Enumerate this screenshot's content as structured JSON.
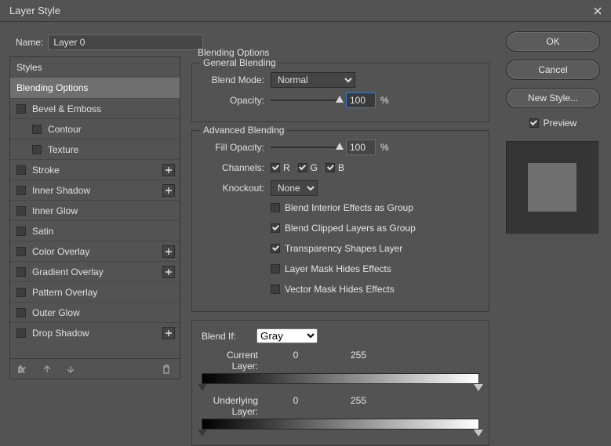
{
  "window": {
    "title": "Layer Style"
  },
  "name": {
    "label": "Name:",
    "value": "Layer 0"
  },
  "styles": {
    "header": "Styles",
    "items": [
      {
        "label": "Blending Options",
        "selected": true
      },
      {
        "label": "Bevel & Emboss",
        "checkbox": true
      },
      {
        "label": "Contour",
        "checkbox": true,
        "indent": true
      },
      {
        "label": "Texture",
        "checkbox": true,
        "indent": true
      },
      {
        "label": "Stroke",
        "checkbox": true,
        "plus": true
      },
      {
        "label": "Inner Shadow",
        "checkbox": true,
        "plus": true
      },
      {
        "label": "Inner Glow",
        "checkbox": true
      },
      {
        "label": "Satin",
        "checkbox": true
      },
      {
        "label": "Color Overlay",
        "checkbox": true,
        "plus": true
      },
      {
        "label": "Gradient Overlay",
        "checkbox": true,
        "plus": true
      },
      {
        "label": "Pattern Overlay",
        "checkbox": true
      },
      {
        "label": "Outer Glow",
        "checkbox": true
      },
      {
        "label": "Drop Shadow",
        "checkbox": true,
        "plus": true
      }
    ]
  },
  "blending": {
    "section_title": "Blending Options",
    "general_legend": "General Blending",
    "blend_mode_label": "Blend Mode:",
    "blend_mode_value": "Normal",
    "opacity_label": "Opacity:",
    "opacity_value": "100",
    "opacity_pct": "%",
    "advanced_legend": "Advanced Blending",
    "fill_opacity_label": "Fill Opacity:",
    "fill_opacity_value": "100",
    "fill_opacity_pct": "%",
    "channels_label": "Channels:",
    "channel_r": "R",
    "channel_g": "G",
    "channel_b": "B",
    "knockout_label": "Knockout:",
    "knockout_value": "None",
    "opt_interior": "Blend Interior Effects as Group",
    "opt_clipped": "Blend Clipped Layers as Group",
    "opt_trans": "Transparency Shapes Layer",
    "opt_layer_mask": "Layer Mask Hides Effects",
    "opt_vector_mask": "Vector Mask Hides Effects",
    "blend_if_label": "Blend If:",
    "blend_if_value": "Gray",
    "current_layer_label": "Current Layer:",
    "current_layer_low": "0",
    "current_layer_high": "255",
    "underlying_layer_label": "Underlying Layer:",
    "underlying_layer_low": "0",
    "underlying_layer_high": "255"
  },
  "buttons": {
    "ok": "OK",
    "cancel": "Cancel",
    "new_style": "New Style...",
    "preview": "Preview"
  }
}
